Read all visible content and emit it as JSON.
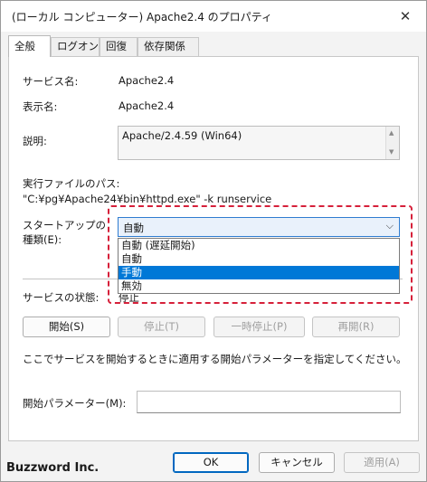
{
  "window": {
    "title": "(ローカル コンピューター) Apache2.4 のプロパティ",
    "close_glyph": "✕"
  },
  "tabs": [
    {
      "label": "全般",
      "active": true
    },
    {
      "label": "ログオン",
      "active": false
    },
    {
      "label": "回復",
      "active": false
    },
    {
      "label": "依存関係",
      "active": false
    }
  ],
  "general": {
    "service_name_label": "サービス名:",
    "service_name_value": "Apache2.4",
    "display_name_label": "表示名:",
    "display_name_value": "Apache2.4",
    "description_label": "説明:",
    "description_value": "Apache/2.4.59 (Win64)",
    "exe_path_label": "実行ファイルのパス:",
    "exe_path_value": "\"C:¥pg¥Apache24¥bin¥httpd.exe\" -k runservice",
    "startup_type_label_line1": "スタートアップの",
    "startup_type_label_line2": "種類(E):",
    "startup_type_selected": "自動",
    "startup_options": [
      {
        "label": "自動 (遅延開始)",
        "selected": false
      },
      {
        "label": "自動",
        "selected": false
      },
      {
        "label": "手動",
        "selected": true
      },
      {
        "label": "無効",
        "selected": false
      }
    ],
    "status_label": "サービスの状態:",
    "status_value": "停止",
    "buttons": {
      "start": "開始(S)",
      "stop": "停止(T)",
      "pause": "一時停止(P)",
      "resume": "再開(R)"
    },
    "hint_text": "ここでサービスを開始するときに適用する開始パラメーターを指定してください。",
    "start_params_label": "開始パラメーター(M):",
    "start_params_value": ""
  },
  "footer": {
    "ok": "OK",
    "cancel": "キャンセル",
    "apply": "適用(A)"
  },
  "watermark": "Buzzword Inc.",
  "colors": {
    "highlight_border": "#d6203a",
    "selection": "#0078d7",
    "accent": "#0067c0"
  }
}
